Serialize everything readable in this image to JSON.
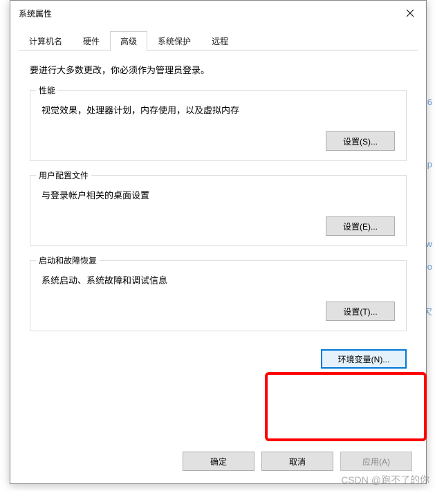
{
  "dialog": {
    "title": "系统属性"
  },
  "tabs": {
    "computer_name": "计算机名",
    "hardware": "硬件",
    "advanced": "高级",
    "system_protection": "系统保护",
    "remote": "远程"
  },
  "admin_note": "要进行大多数更改，你必须作为管理员登录。",
  "performance": {
    "title": "性能",
    "desc": "视觉效果，处理器计划，内存使用，以及虚拟内存",
    "button": "设置(S)..."
  },
  "user_profiles": {
    "title": "用户配置文件",
    "desc": "与登录帐户相关的桌面设置",
    "button": "设置(E)..."
  },
  "startup_recovery": {
    "title": "启动和故障恢复",
    "desc": "系统启动、系统故障和调试信息",
    "button": "设置(T)..."
  },
  "env_vars_button": "环境变量(N)...",
  "footer": {
    "ok": "确定",
    "cancel": "取消",
    "apply": "应用(A)"
  },
  "watermark": "CSDN @跑不了的你"
}
